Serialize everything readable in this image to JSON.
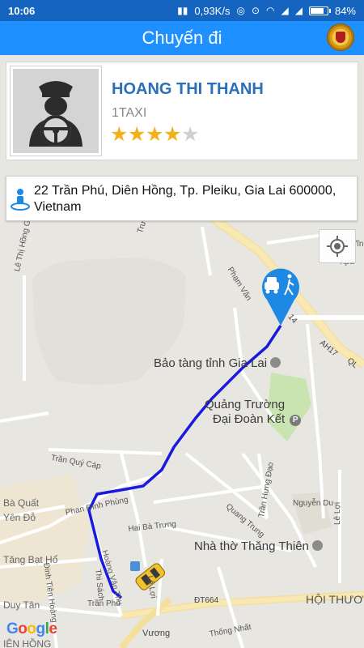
{
  "status_bar": {
    "time": "10:06",
    "speed": "0,93K/s",
    "battery": "84%",
    "battery_level": 0.84
  },
  "app_bar": {
    "title": "Chuyến đi",
    "logo_icon": "company-seal-icon"
  },
  "driver": {
    "name": "HOANG THI THANH",
    "company": "1TAXI",
    "rating": 4,
    "rating_max": 5,
    "photo_icon": "driver-avatar-icon"
  },
  "address": {
    "text": "22 Trần Phú, Diên Hồng, Tp. Pleiku, Gia Lai 600000, Vietnam",
    "icon": "person-pin-icon"
  },
  "map": {
    "locate_icon": "my-location-icon",
    "destination_icon": "car-walk-marker-icon",
    "vehicle_icon": "taxi-car-icon",
    "route_color": "#1a1adf",
    "pois": {
      "museum": "Bảo tàng tỉnh Gia Lai",
      "square_line1": "Quảng Trường",
      "square_line2": "Đại Đoàn Kết",
      "church": "Nhà thờ Thăng Thiên",
      "area_bottom_right": "HỘI THƯƠ",
      "area_left_1": "Tăng Bạt Hổ",
      "area_left_2": "Bà Quất",
      "area_left_3": "Yên Đỗ",
      "area_left_bottom": "Duy Tân",
      "area_bottom_left": "IÊN HỒNG"
    },
    "streets": {
      "le_thi_hong_gam": "Lê Thị Hồng Gấm",
      "truong_lan": "Trương Lân",
      "pham_van": "Phạm Văn",
      "route_14": "14",
      "ah17": "AH17",
      "ql": "QL",
      "to_vinh": "Tô Vĩnh",
      "kpa": "Kpa",
      "tran_quy_cap": "Trần Quý Cáp",
      "phan_dinh_phung": "Phan Đình Phùng",
      "hai_ba_trung": "Hai Bà Trưng",
      "quang_trung": "Quang Trung",
      "tran_hung_dao": "Trần Hưng Đạo",
      "nguyen_du": "Nguyễn Du",
      "le_loi_1": "Lê Lợi",
      "le_loi_2": "Lê Lợi",
      "dinh_tien_hoang": "Đinh Tiên Hoàng",
      "thi_sach": "Thi Sách",
      "tran_phu": "Trần Phú",
      "hoang_van_thu": "Hoàng Văn Thụ",
      "dt664": "ĐT664",
      "vuong": "Vương",
      "thong_nhat": "Thống Nhất"
    },
    "attribution": [
      "G",
      "o",
      "o",
      "g",
      "l",
      "e"
    ]
  }
}
